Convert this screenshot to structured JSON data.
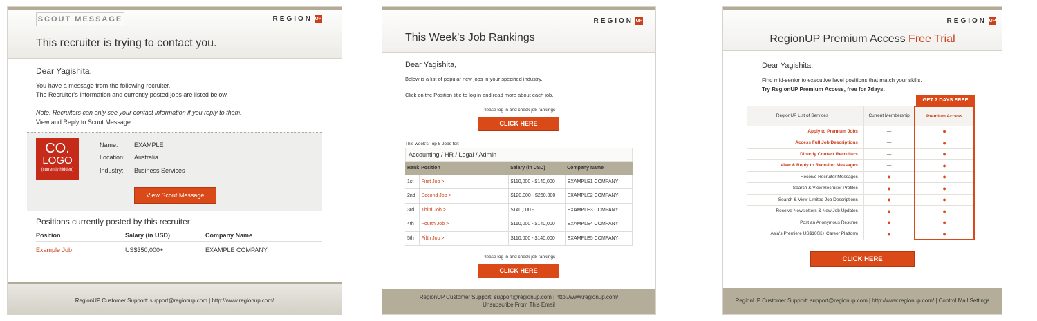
{
  "brand": {
    "logo_text": "REGION",
    "logo_mark": "UP",
    "accent": "#d94a18"
  },
  "scout": {
    "tab": "SCOUT MESSAGE",
    "title": "This recruiter is trying to contact you.",
    "greeting": "Dear Yagishita,",
    "line1": "You have a message from the following recruiter.",
    "line2": "The Recruiter's information and currently posted jobs are listed below.",
    "note": "Note: Recruiters can only see your contact information if you reply to them.",
    "reply_link": "View and Reply to Scout Message",
    "company_logo": {
      "line1": "CO.",
      "line2": "LOGO",
      "caption": "(currently hidden)"
    },
    "info": [
      {
        "label": "Name:",
        "value": "EXAMPLE"
      },
      {
        "label": "Location:",
        "value": "Australia"
      },
      {
        "label": "Industry:",
        "value": "Business Services"
      }
    ],
    "view_button": "View Scout Message",
    "positions_title": "Positions currently posted by this recruiter:",
    "columns": [
      "Position",
      "Salary (in USD)",
      "Company Name"
    ],
    "rows": [
      {
        "position": "Example Job",
        "salary": "US$350,000+",
        "company": "EXAMPLE COMPANY"
      }
    ],
    "footer": "RegionUP Customer Support:   support@regionup.com   |   http://www.regionup.com/"
  },
  "rankings": {
    "title": "This Week's Job Rankings",
    "greeting": "Dear Yagishita,",
    "line1": "Below is a list of popular new jobs in your specified industry.",
    "line2": "Click on the Position title to log in and read more about each job.",
    "login_note": "Please log in and check job rankings",
    "click_button": "CLICK HERE",
    "top5_label": "This week's Top 5 Jobs for:",
    "category": "Accounting / HR / Legal / Admin",
    "columns": [
      "Rank",
      "Position",
      "Salary (in USD)",
      "Company Name"
    ],
    "rows": [
      {
        "rank": "1st",
        "position": "First Job >",
        "salary": "$110,000 - $140,000",
        "company": "EXAMPLE1 COMPANY"
      },
      {
        "rank": "2nd",
        "position": "Second Job >",
        "salary": "$120,000 - $260,000",
        "company": "EXAMPLE2 COMPANY"
      },
      {
        "rank": "3rd",
        "position": "Third Job >",
        "salary": "$140,000 -",
        "company": "EXAMPLE3 COMPANY"
      },
      {
        "rank": "4th",
        "position": "Fourth Job >",
        "salary": "$110,000 - $140,000",
        "company": "EXAMPLE4 COMPANY"
      },
      {
        "rank": "5th",
        "position": "Fifth Job >",
        "salary": "$110,000 - $140,000",
        "company": "EXAMPLE5 COMPANY"
      }
    ],
    "login_note2": "Please log in and check job rankings",
    "click_button2": "CLICK HERE",
    "footer_line1": "RegionUP Customer Support:   support@regionup.com   |   http://www.regionup.com/",
    "footer_line2": "Unsubscribe From This Email"
  },
  "premium": {
    "title_main": "RegionUP Premium Access ",
    "title_accent": "Free Trial",
    "greeting": "Dear Yagishita,",
    "line1": "Find mid-senior to executive level positions that match your skills.",
    "line2": "Try RegionUP Premium Access, free for 7days.",
    "badge": "GET 7 DAYS FREE",
    "columns": {
      "services": "RegionUP List of Services",
      "current": "Current Membership",
      "premium": "Premium Access"
    },
    "rows": [
      {
        "service": "Apply to Premium Jobs",
        "highlight": true,
        "current": "—",
        "premium": "●"
      },
      {
        "service": "Access Full Job Descriptions",
        "highlight": true,
        "current": "—",
        "premium": "●"
      },
      {
        "service": "Directly Contact Recruiters",
        "highlight": true,
        "current": "—",
        "premium": "●"
      },
      {
        "service": "View & Reply to Recruiter Messages",
        "highlight": true,
        "current": "—",
        "premium": "●"
      },
      {
        "service": "Receive Recruiter Messages",
        "highlight": false,
        "current": "●",
        "premium": "●"
      },
      {
        "service": "Search & View Recruiter Profiles",
        "highlight": false,
        "current": "●",
        "premium": "●"
      },
      {
        "service": "Search & View Limited Job Descriptions",
        "highlight": false,
        "current": "●",
        "premium": "●"
      },
      {
        "service": "Receive Newsletters & New Job Updates",
        "highlight": false,
        "current": "●",
        "premium": "●"
      },
      {
        "service": "Post an Anonymous Resume",
        "highlight": false,
        "current": "●",
        "premium": "●"
      },
      {
        "service": "Asia's Premiere US$100K+ Career Platform",
        "highlight": false,
        "current": "●",
        "premium": "●"
      }
    ],
    "click_button": "CLICK HERE",
    "footer": "RegionUP Customer Support:   support@regionup.com   |   http://www.regionup.com/   |   Control Mail Settings"
  }
}
